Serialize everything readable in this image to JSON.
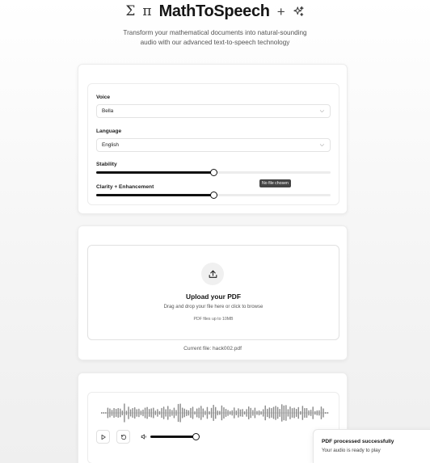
{
  "header": {
    "symbol_sigma": "Σ",
    "symbol_pi": "π",
    "brand": "MathToSpeech",
    "symbol_plus": "+",
    "sparkle_icon": "sparkles-icon"
  },
  "subtitle": {
    "line1": "Transform your mathematical documents into natural-sounding",
    "line2": "audio with our advanced text-to-speech technology"
  },
  "settings": {
    "voice_label": "Voice",
    "voice_value": "Bella",
    "language_label": "Language",
    "language_value": "English",
    "stability_label": "Stability",
    "stability_value": 0.5,
    "clarity_label": "Clarity + Enhancement",
    "clarity_value": 0.5,
    "chevron_icon": "chevron-down-icon"
  },
  "tooltip": {
    "text": "No file chosen"
  },
  "upload": {
    "icon": "upload-icon",
    "title": "Upload your PDF",
    "description": "Drag and drop your file here or click to browse",
    "hint": "PDF files up to 10MB",
    "current_file": "Current file: hack002.pdf"
  },
  "player": {
    "play_icon": "play-icon",
    "restart_icon": "rotate-ccw-icon",
    "volume_icon": "volume-icon",
    "volume_value": 1.0,
    "colors": {
      "wave": "#8a8a8a",
      "accent": "#111111"
    }
  },
  "toast": {
    "title": "PDF processed successfully",
    "description": "Your audio is ready to play"
  }
}
